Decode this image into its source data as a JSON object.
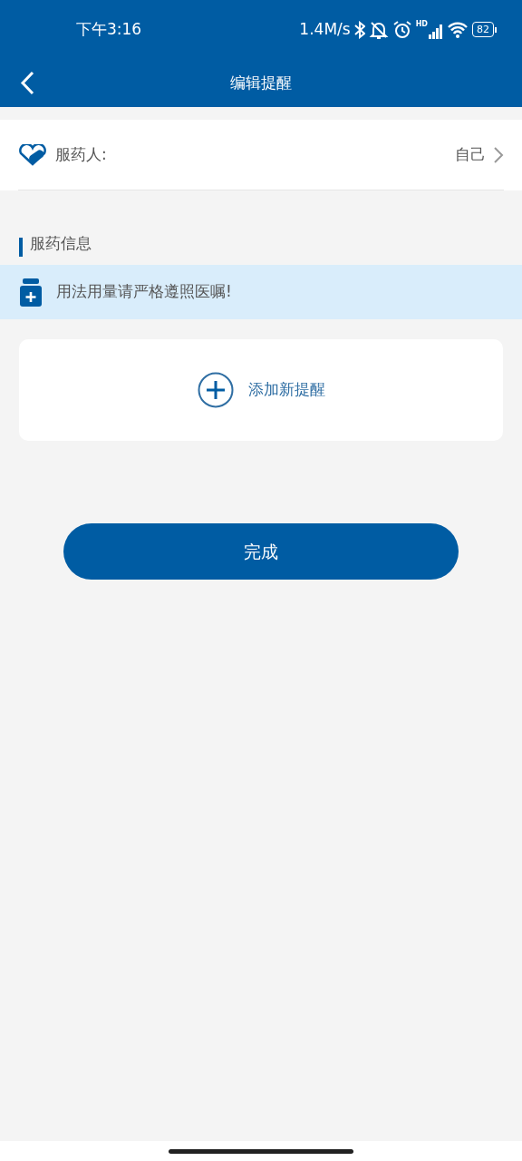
{
  "status_bar": {
    "time": "下午3:16",
    "net_speed": "1.4M/s",
    "signal_label": "HD",
    "battery": "82"
  },
  "nav": {
    "title": "编辑提醒"
  },
  "taker": {
    "label": "服药人:",
    "value": "自己"
  },
  "section": {
    "title": "服药信息"
  },
  "notice": {
    "text": "用法用量请严格遵照医嘱!"
  },
  "add_card": {
    "label": "添加新提醒"
  },
  "done_button": {
    "label": "完成"
  }
}
